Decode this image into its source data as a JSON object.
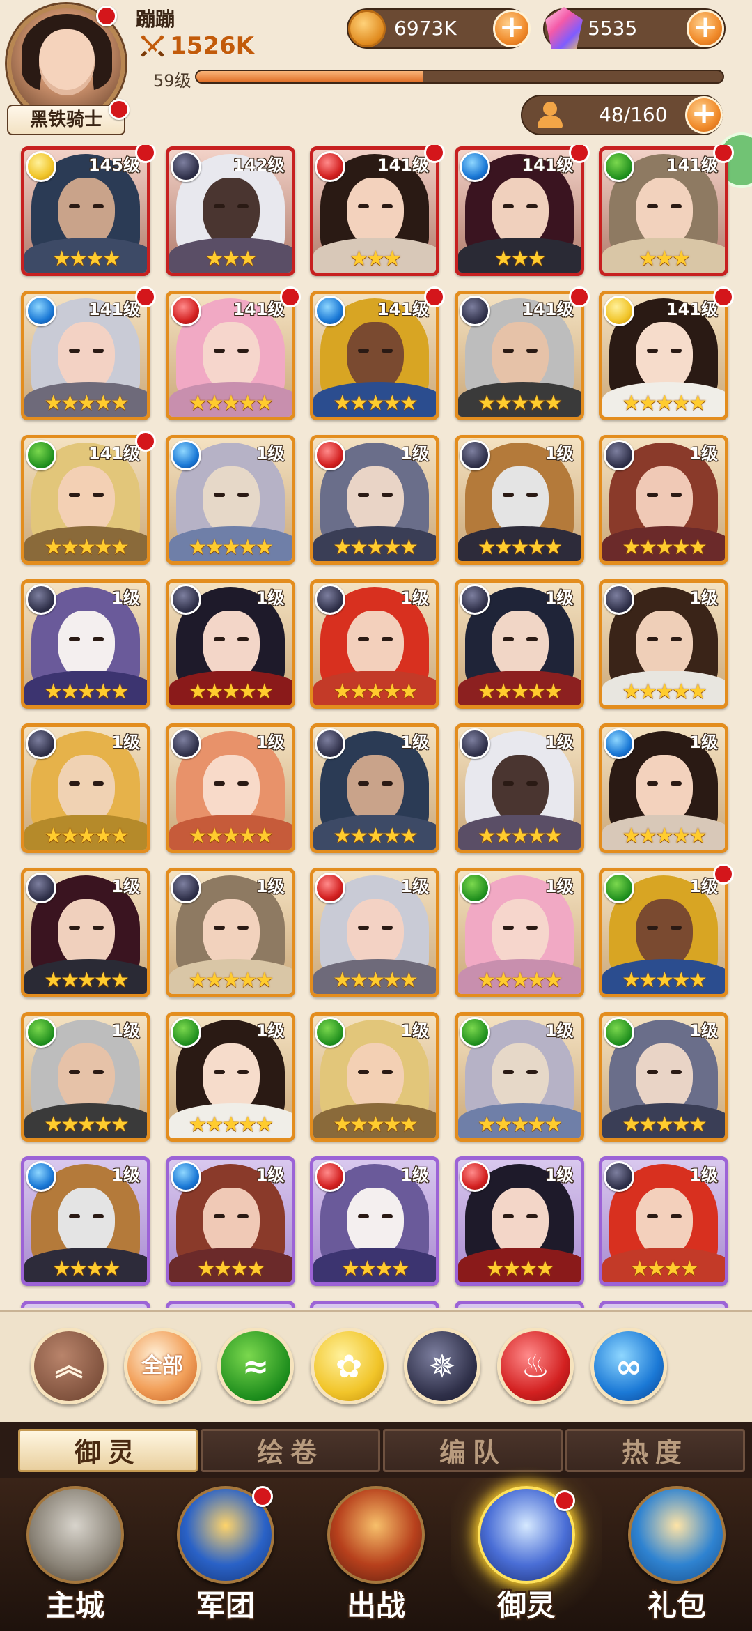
{
  "player": {
    "name": "蹦蹦",
    "power": "1526K",
    "title": "黑铁骑士",
    "level_label": "59级",
    "exp_progress": 0.43
  },
  "resources": {
    "coins": "6973K",
    "gems": "5535",
    "roster": "48/160"
  },
  "icons": {
    "power": "crossed-swords-icon",
    "coin": "gold-coin-icon",
    "gem": "crystal-gem-icon",
    "roster": "person-icon",
    "plus": "+"
  },
  "element_colors": {
    "light": "#f1c52a",
    "dark": "#2f3049",
    "fire": "#d32121",
    "water": "#1b79d6",
    "nature": "#1c8c1c"
  },
  "cards": [
    {
      "element": "light",
      "level": "145级",
      "stars": 4,
      "rarity": "red",
      "dot": true
    },
    {
      "element": "dark",
      "level": "142级",
      "stars": 3,
      "rarity": "red",
      "dot": false
    },
    {
      "element": "fire",
      "level": "141级",
      "stars": 3,
      "rarity": "red",
      "dot": true
    },
    {
      "element": "water",
      "level": "141级",
      "stars": 3,
      "rarity": "red",
      "dot": true
    },
    {
      "element": "nature",
      "level": "141级",
      "stars": 3,
      "rarity": "red",
      "dot": true
    },
    {
      "element": "water",
      "level": "141级",
      "stars": 5,
      "rarity": "orange",
      "dot": true
    },
    {
      "element": "fire",
      "level": "141级",
      "stars": 5,
      "rarity": "orange",
      "dot": true
    },
    {
      "element": "water",
      "level": "141级",
      "stars": 5,
      "rarity": "orange",
      "dot": true
    },
    {
      "element": "dark",
      "level": "141级",
      "stars": 5,
      "rarity": "orange",
      "dot": true
    },
    {
      "element": "light",
      "level": "141级",
      "stars": 5,
      "rarity": "orange",
      "dot": true
    },
    {
      "element": "nature",
      "level": "141级",
      "stars": 5,
      "rarity": "orange",
      "dot": true
    },
    {
      "element": "water",
      "level": "1级",
      "stars": 5,
      "rarity": "orange",
      "dot": false
    },
    {
      "element": "fire",
      "level": "1级",
      "stars": 5,
      "rarity": "orange",
      "dot": false
    },
    {
      "element": "dark",
      "level": "1级",
      "stars": 5,
      "rarity": "orange",
      "dot": false
    },
    {
      "element": "dark",
      "level": "1级",
      "stars": 5,
      "rarity": "orange",
      "dot": false
    },
    {
      "element": "dark",
      "level": "1级",
      "stars": 5,
      "rarity": "orange",
      "dot": false
    },
    {
      "element": "dark",
      "level": "1级",
      "stars": 5,
      "rarity": "orange",
      "dot": false
    },
    {
      "element": "dark",
      "level": "1级",
      "stars": 5,
      "rarity": "orange",
      "dot": false
    },
    {
      "element": "dark",
      "level": "1级",
      "stars": 5,
      "rarity": "orange",
      "dot": false
    },
    {
      "element": "dark",
      "level": "1级",
      "stars": 5,
      "rarity": "orange",
      "dot": false
    },
    {
      "element": "dark",
      "level": "1级",
      "stars": 5,
      "rarity": "orange",
      "dot": false
    },
    {
      "element": "dark",
      "level": "1级",
      "stars": 5,
      "rarity": "orange",
      "dot": false
    },
    {
      "element": "dark",
      "level": "1级",
      "stars": 5,
      "rarity": "orange",
      "dot": false
    },
    {
      "element": "dark",
      "level": "1级",
      "stars": 5,
      "rarity": "orange",
      "dot": false
    },
    {
      "element": "water",
      "level": "1级",
      "stars": 5,
      "rarity": "orange",
      "dot": false
    },
    {
      "element": "dark",
      "level": "1级",
      "stars": 5,
      "rarity": "orange",
      "dot": false
    },
    {
      "element": "dark",
      "level": "1级",
      "stars": 5,
      "rarity": "orange",
      "dot": false
    },
    {
      "element": "fire",
      "level": "1级",
      "stars": 5,
      "rarity": "orange",
      "dot": false
    },
    {
      "element": "nature",
      "level": "1级",
      "stars": 5,
      "rarity": "orange",
      "dot": false
    },
    {
      "element": "nature",
      "level": "1级",
      "stars": 5,
      "rarity": "orange",
      "dot": true
    },
    {
      "element": "nature",
      "level": "1级",
      "stars": 5,
      "rarity": "orange",
      "dot": false
    },
    {
      "element": "nature",
      "level": "1级",
      "stars": 5,
      "rarity": "orange",
      "dot": false
    },
    {
      "element": "nature",
      "level": "1级",
      "stars": 5,
      "rarity": "orange",
      "dot": false
    },
    {
      "element": "nature",
      "level": "1级",
      "stars": 5,
      "rarity": "orange",
      "dot": false
    },
    {
      "element": "nature",
      "level": "1级",
      "stars": 5,
      "rarity": "orange",
      "dot": false
    },
    {
      "element": "water",
      "level": "1级",
      "stars": 4,
      "rarity": "purple",
      "dot": false
    },
    {
      "element": "water",
      "level": "1级",
      "stars": 4,
      "rarity": "purple",
      "dot": false
    },
    {
      "element": "fire",
      "level": "1级",
      "stars": 4,
      "rarity": "purple",
      "dot": false
    },
    {
      "element": "fire",
      "level": "1级",
      "stars": 4,
      "rarity": "purple",
      "dot": false
    },
    {
      "element": "dark",
      "level": "1级",
      "stars": 4,
      "rarity": "purple",
      "dot": false
    }
  ],
  "filters": {
    "collapse_icon": "double-chevron-up-icon",
    "all_label": "全部",
    "elements": [
      "nature",
      "light",
      "dark",
      "fire",
      "water"
    ]
  },
  "tabs": [
    {
      "label": "御灵",
      "active": true
    },
    {
      "label": "绘卷",
      "active": false
    },
    {
      "label": "编队",
      "active": false
    },
    {
      "label": "热度",
      "active": false
    }
  ],
  "nav": [
    {
      "label": "主城",
      "icon": "castle-icon",
      "active": false,
      "dot": false
    },
    {
      "label": "军团",
      "icon": "legion-fist-shield-icon",
      "active": false,
      "dot": true
    },
    {
      "label": "出战",
      "icon": "battle-sword-icon",
      "active": false,
      "dot": false
    },
    {
      "label": "御灵",
      "icon": "crystal-spirit-icon",
      "active": true,
      "dot": true
    },
    {
      "label": "礼包",
      "icon": "gift-shop-icon",
      "active": false,
      "dot": false
    }
  ]
}
